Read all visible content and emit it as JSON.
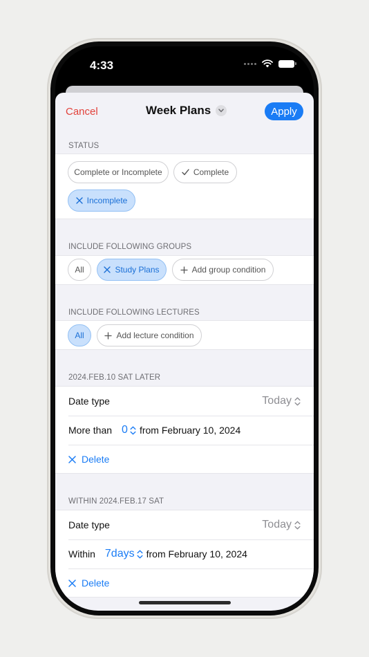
{
  "status_bar": {
    "time": "4:33"
  },
  "nav": {
    "cancel_label": "Cancel",
    "title": "Week Plans",
    "apply_label": "Apply"
  },
  "status_section": {
    "header": "STATUS",
    "chips": [
      {
        "label": "Complete or Incomplete",
        "selected": false
      },
      {
        "label": "Complete",
        "selected": false
      },
      {
        "label": "Incomplete",
        "selected": true
      }
    ]
  },
  "groups_section": {
    "header": "INCLUDE FOLLOWING GROUPS",
    "chips": [
      {
        "label": "All",
        "selected": false
      },
      {
        "label": "Study Plans",
        "selected": true
      },
      {
        "label": "Add group condition",
        "selected": false
      }
    ]
  },
  "lectures_section": {
    "header": "INCLUDE FOLLOWING LECTURES",
    "chips": [
      {
        "label": "All",
        "selected": true
      },
      {
        "label": "Add lecture condition",
        "selected": false
      }
    ]
  },
  "later_section": {
    "header": "2024.FEB.10 SAT LATER",
    "date_type_label": "Date type",
    "date_type_value": "Today",
    "more_than_label": "More than",
    "more_than_value": "0",
    "from_text": "from February 10, 2024",
    "delete_label": "Delete"
  },
  "within_section": {
    "header": "WITHIN 2024.FEB.17 SAT",
    "date_type_label": "Date type",
    "date_type_value": "Today",
    "within_label": "Within",
    "within_value": "7days",
    "from_text": "from February 10, 2024",
    "delete_label": "Delete"
  },
  "colors": {
    "accent": "#1a7cf5",
    "cancel": "#e2423b",
    "chip_selected_bg": "#c9e0fc"
  }
}
